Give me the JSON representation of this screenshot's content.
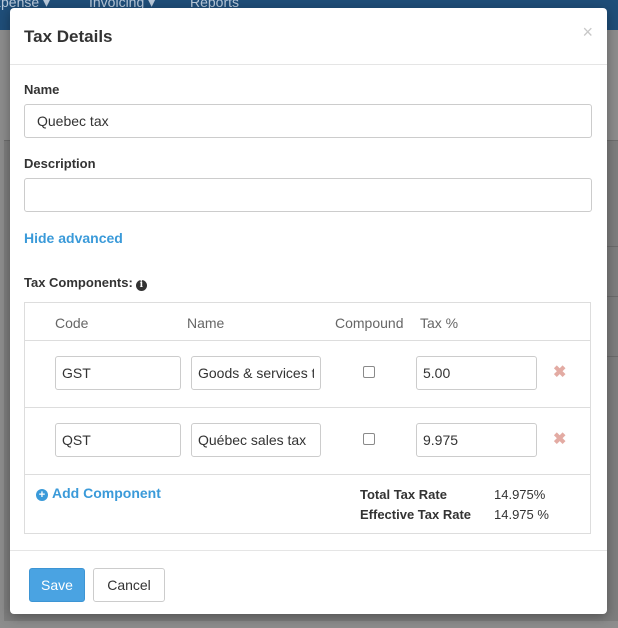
{
  "background": {
    "nav_items": [
      "xpense ▾",
      "Invoicing ▾",
      "Reports"
    ]
  },
  "modal": {
    "title": "Tax Details",
    "close_symbol": "×"
  },
  "form": {
    "name_label": "Name",
    "name_value": "Quebec tax",
    "description_label": "Description",
    "description_value": "",
    "hide_advanced_label": "Hide advanced"
  },
  "components": {
    "label": "Tax Components:",
    "headers": {
      "code": "Code",
      "name": "Name",
      "compound": "Compound",
      "tax": "Tax %"
    },
    "rows": [
      {
        "code": "GST",
        "name": "Goods & services tax",
        "compound": false,
        "tax": "5.00"
      },
      {
        "code": "QST",
        "name": "Québec sales tax",
        "compound": false,
        "tax": "9.975"
      }
    ],
    "add_label": "Add Component",
    "total_tax_rate_label": "Total Tax Rate",
    "total_tax_rate_value": "14.975%",
    "effective_tax_rate_label": "Effective Tax Rate",
    "effective_tax_rate_value": "14.975 %"
  },
  "footer": {
    "save_label": "Save",
    "cancel_label": "Cancel"
  },
  "colors": {
    "accent": "#3a9ad9",
    "save_button": "#4aa3e2",
    "remove_icon": "#e3aba3"
  }
}
